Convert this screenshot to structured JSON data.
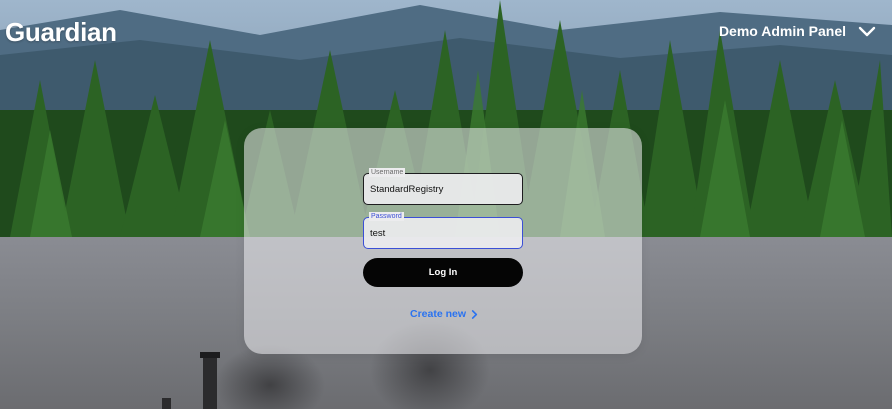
{
  "header": {
    "brand": "Guardian",
    "admin_menu_label": "Demo Admin Panel"
  },
  "login": {
    "username": {
      "label": "Username",
      "value": "StandardRegistry"
    },
    "password": {
      "label": "Password",
      "value": "test"
    },
    "login_button": "Log In",
    "create_new_link": "Create new"
  },
  "colors": {
    "accent_link": "#2a73f0",
    "focus_border": "#3b4fd6",
    "button_bg": "#050505"
  },
  "icons": {
    "menu_toggle": "chevron-down-icon",
    "create_arrow": "chevron-right-icon"
  }
}
